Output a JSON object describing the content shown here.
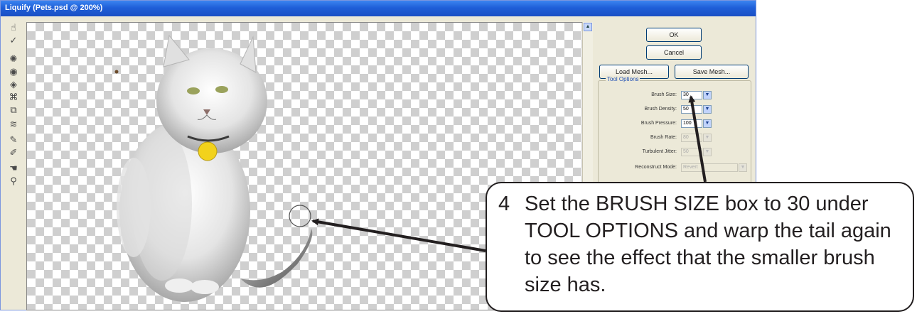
{
  "window": {
    "title": "Liquify (Pets.psd @ 200%)"
  },
  "toolbox": {
    "tools": [
      {
        "icon": "forward-warp-icon",
        "glyph": "☝"
      },
      {
        "icon": "reconstruct-icon",
        "glyph": "✓"
      },
      {
        "icon": "twirl-icon",
        "glyph": "✺"
      },
      {
        "icon": "pucker-icon",
        "glyph": "◉"
      },
      {
        "icon": "bloat-icon",
        "glyph": "◈"
      },
      {
        "icon": "push-left-icon",
        "glyph": "⌘"
      },
      {
        "icon": "mirror-icon",
        "glyph": "⧉"
      },
      {
        "icon": "turbulence-icon",
        "glyph": "≋"
      },
      {
        "icon": "freeze-mask-icon",
        "glyph": "✎"
      },
      {
        "icon": "thaw-mask-icon",
        "glyph": "✐"
      },
      {
        "icon": "hand-icon",
        "glyph": "☚"
      },
      {
        "icon": "zoom-icon",
        "glyph": "⚲"
      }
    ]
  },
  "panel": {
    "ok_label": "OK",
    "cancel_label": "Cancel",
    "load_mesh_label": "Load Mesh...",
    "save_mesh_label": "Save Mesh...",
    "tool_options_title": "Tool Options",
    "rows": [
      {
        "label": "Brush Size:",
        "value": "30",
        "enabled": true
      },
      {
        "label": "Brush Density:",
        "value": "50",
        "enabled": true
      },
      {
        "label": "Brush Pressure:",
        "value": "100",
        "enabled": true
      },
      {
        "label": "Brush Rate:",
        "value": "80",
        "enabled": false
      },
      {
        "label": "Turbulent Jitter:",
        "value": "50",
        "enabled": false
      }
    ],
    "reconstruct_label": "Reconstruct Mode:",
    "reconstruct_value": "Revert"
  },
  "callout": {
    "step_number": "4",
    "text": "Set the BRUSH SIZE box to 30 under TOOL OPTIONS and warp the tail again to see the effect that the smaller brush size has."
  },
  "colors": {
    "titlebar": "#1f5fd8",
    "dialog_bg": "#ece9d8",
    "callout_border": "#231f20",
    "cat_tag": "#f2d21b"
  }
}
